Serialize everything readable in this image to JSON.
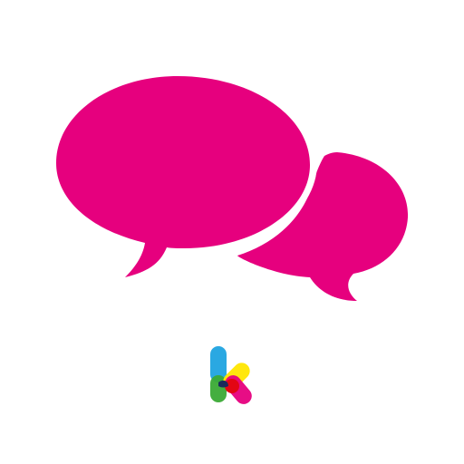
{
  "icon": {
    "name": "chat-bubbles-icon",
    "color": "#e6007e",
    "background": "#ffffff"
  },
  "logo": {
    "name": "k-logo-icon",
    "colors": {
      "blue": "#1fa3e0",
      "yellow": "#ffe600",
      "magenta": "#e6007e",
      "green": "#3aaa35",
      "red": "#e30613",
      "purple": "#5a2a82",
      "dark": "#1a2a5a"
    }
  }
}
